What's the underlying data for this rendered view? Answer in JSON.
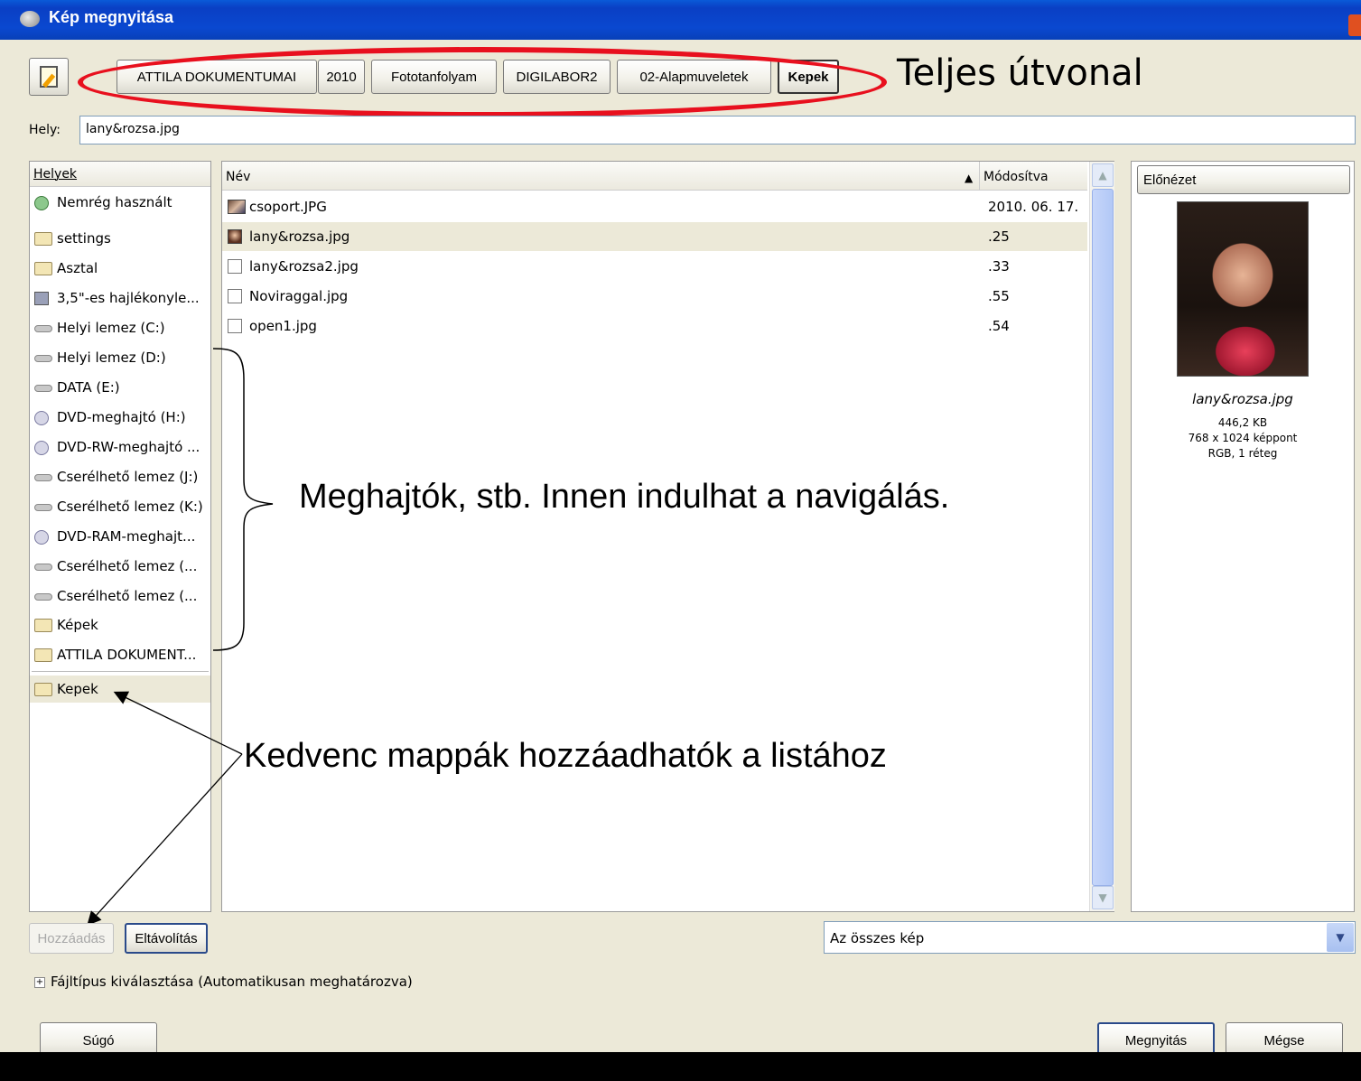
{
  "window": {
    "title": "Kép megnyitása"
  },
  "path_bar": {
    "buttons": [
      "ATTILA DOKUMENTUMAI",
      "2010",
      "Fototanfolyam",
      "DIGILABOR2",
      "02-Alapmuveletek",
      "Kepek"
    ]
  },
  "annotations": {
    "path": "Teljes útvonal",
    "drives": "Meghajtók, stb.  Innen indulhat a navigálás.",
    "favorites": "Kedvenc mappák hozzáadhatók a listához"
  },
  "location": {
    "label": "Hely:",
    "value": "lany&rozsa.jpg"
  },
  "places": {
    "header": "Helyek",
    "items": [
      {
        "label": "Nemrég használt",
        "icon": "recent-icon"
      },
      {
        "label": "settings",
        "icon": "folder-icon"
      },
      {
        "label": "Asztal",
        "icon": "folder-icon"
      },
      {
        "label": "3,5\"-es hajlékonyle...",
        "icon": "floppy-icon"
      },
      {
        "label": "Helyi lemez (C:)",
        "icon": "drive-icon"
      },
      {
        "label": "Helyi lemez (D:)",
        "icon": "drive-icon"
      },
      {
        "label": "DATA (E:)",
        "icon": "drive-icon"
      },
      {
        "label": "DVD-meghajtó (H:)",
        "icon": "optical-drive-icon"
      },
      {
        "label": "DVD-RW-meghajtó ...",
        "icon": "optical-drive-icon"
      },
      {
        "label": "Cserélhető lemez (J:)",
        "icon": "drive-icon"
      },
      {
        "label": "Cserélhető lemez (K:)",
        "icon": "drive-icon"
      },
      {
        "label": "DVD-RAM-meghajt...",
        "icon": "optical-drive-icon"
      },
      {
        "label": "Cserélhető lemez (...",
        "icon": "drive-icon"
      },
      {
        "label": "Cserélhető lemez (...",
        "icon": "drive-icon"
      },
      {
        "label": "Képek",
        "icon": "folder-icon"
      },
      {
        "label": "ATTILA DOKUMENT...",
        "icon": "folder-icon"
      }
    ],
    "bookmarks": [
      {
        "label": "Kepek",
        "icon": "folder-icon"
      }
    ]
  },
  "files": {
    "columns": {
      "name": "Név",
      "modified": "Módosítva"
    },
    "rows": [
      {
        "name": "csoport.JPG",
        "modified": "2010. 06. 17.",
        "icon": "photo-icon"
      },
      {
        "name": "lany&rozsa.jpg",
        "modified": ".25",
        "icon": "portrait-icon"
      },
      {
        "name": "lany&rozsa2.jpg",
        "modified": ".33",
        "icon": "image-file-icon"
      },
      {
        "name": "Noviraggal.jpg",
        "modified": ".55",
        "icon": "image-file-icon"
      },
      {
        "name": "open1.jpg",
        "modified": ".54",
        "icon": "image-file-icon"
      }
    ]
  },
  "preview": {
    "button": "Előnézet",
    "filename": "lany&rozsa.jpg",
    "size": "446,2 KB",
    "dimensions": "768 x 1024 képpont",
    "mode": "RGB, 1 réteg"
  },
  "bookmark_buttons": {
    "add": "Hozzáadás",
    "remove": "Eltávolítás"
  },
  "filter": {
    "value": "Az összes kép"
  },
  "filetype": {
    "label": "Fájltípus kiválasztása (Automatikusan meghatározva)"
  },
  "dialog_buttons": {
    "help": "Súgó",
    "open": "Megnyitás",
    "cancel": "Mégse"
  }
}
